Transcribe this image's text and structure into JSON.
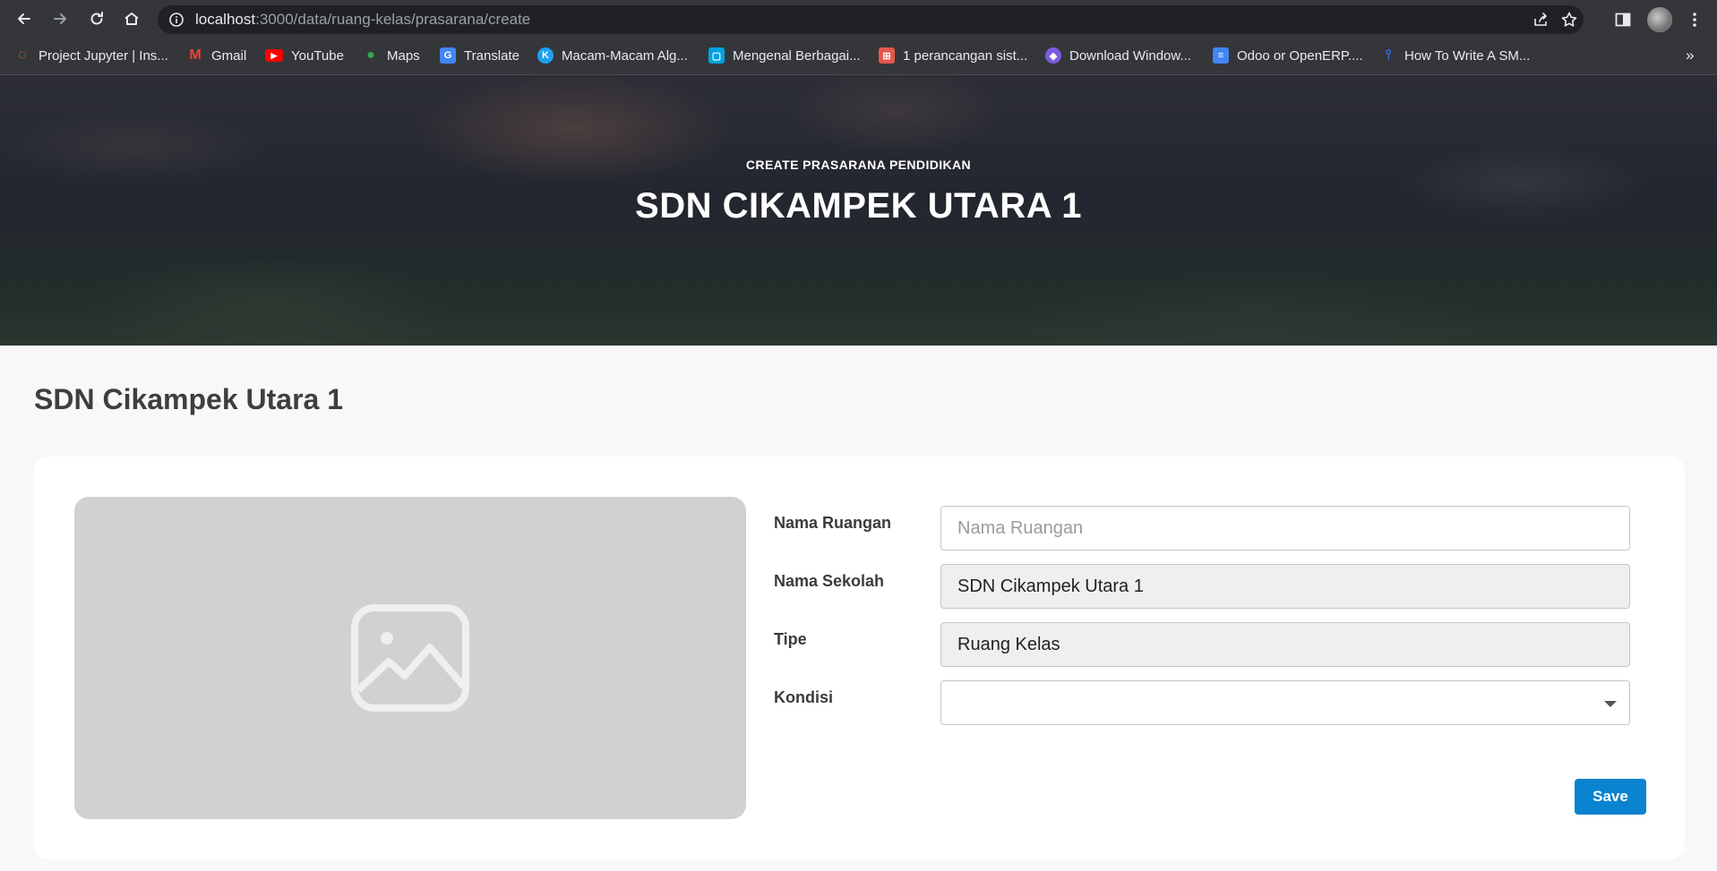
{
  "browser": {
    "url_host": "localhost",
    "url_path": ":3000/data/ruang-kelas/prasarana/create",
    "bookmarks": [
      {
        "label": "Project Jupyter | Ins...",
        "icon": "jupyter-icon",
        "color": "#f37726"
      },
      {
        "label": "Gmail",
        "icon": "gmail-icon",
        "color": "#ea4335"
      },
      {
        "label": "YouTube",
        "icon": "youtube-icon",
        "color": "#ff0000"
      },
      {
        "label": "Maps",
        "icon": "maps-icon",
        "color": "#34a853"
      },
      {
        "label": "Translate",
        "icon": "translate-icon",
        "color": "#4285f4"
      },
      {
        "label": "Macam-Macam Alg...",
        "icon": "k-icon",
        "color": "#1da1f2"
      },
      {
        "label": "Mengenal Berbagai...",
        "icon": "square-icon",
        "color": "#00a3e0"
      },
      {
        "label": "1 perancangan sist...",
        "icon": "doc-icon",
        "color": "#e4574a"
      },
      {
        "label": "Download Window...",
        "icon": "window-icon",
        "color": "#7b5ce0"
      },
      {
        "label": "Odoo or OpenERP....",
        "icon": "docs-icon",
        "color": "#4285f4"
      },
      {
        "label": "How To Write A SM...",
        "icon": "pin-icon",
        "color": "#3b6cf0"
      }
    ],
    "bookmarks_more": "»"
  },
  "hero": {
    "subtitle": "CREATE PRASARANA PENDIDIKAN",
    "title": "SDN CIKAMPEK UTARA 1"
  },
  "page": {
    "title": "SDN Cikampek Utara 1"
  },
  "form": {
    "nama_ruangan": {
      "label": "Nama Ruangan",
      "value": "",
      "placeholder": "Nama Ruangan"
    },
    "nama_sekolah": {
      "label": "Nama Sekolah",
      "value": "SDN Cikampek Utara 1"
    },
    "tipe": {
      "label": "Tipe",
      "value": "Ruang Kelas"
    },
    "kondisi": {
      "label": "Kondisi",
      "value": ""
    },
    "save_label": "Save"
  },
  "colors": {
    "accent": "#0a83d1",
    "placeholder_bg": "#d2d1d2"
  }
}
